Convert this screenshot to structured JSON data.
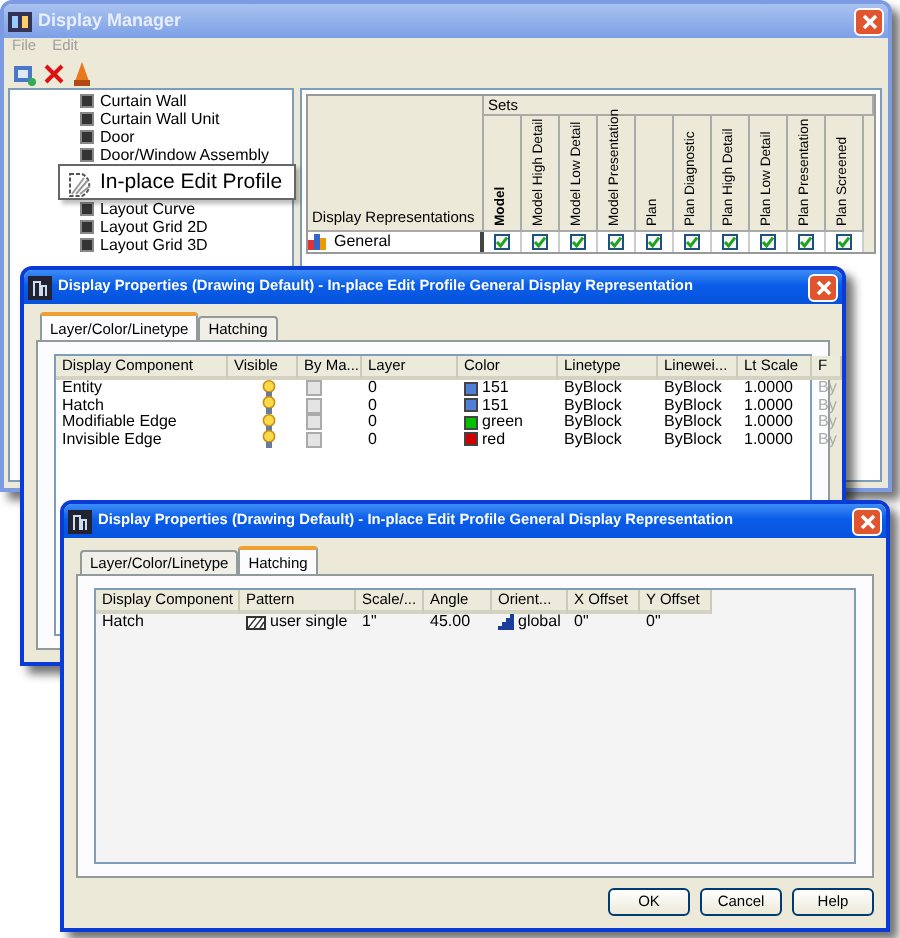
{
  "display_manager": {
    "title": "Display Manager",
    "menu": [
      "File",
      "Edit"
    ],
    "tree": [
      {
        "label": "Curtain Wall",
        "kind": "item"
      },
      {
        "label": "Curtain Wall Unit",
        "kind": "item"
      },
      {
        "label": "Door",
        "kind": "item"
      },
      {
        "label": "Door/Window Assembly",
        "kind": "item"
      },
      {
        "label": "In-place Edit Profile",
        "kind": "tooltip"
      },
      {
        "label": "Layout Curve",
        "kind": "item"
      },
      {
        "label": "Layout Grid 2D",
        "kind": "item"
      },
      {
        "label": "Layout Grid 3D",
        "kind": "item"
      }
    ],
    "representations_header": "Display Representations",
    "sets_header": "Sets",
    "sets": [
      {
        "label": "Model",
        "current": true
      },
      {
        "label": "Model High Detail",
        "current": false
      },
      {
        "label": "Model Low Detail",
        "current": false
      },
      {
        "label": "Model Presentation",
        "current": false
      },
      {
        "label": "Plan",
        "current": false
      },
      {
        "label": "Plan Diagnostic",
        "current": false
      },
      {
        "label": "Plan High Detail",
        "current": false
      },
      {
        "label": "Plan Low Detail",
        "current": false
      },
      {
        "label": "Plan Presentation",
        "current": false
      },
      {
        "label": "Plan Screened",
        "current": false
      }
    ],
    "rows": [
      {
        "label": "General",
        "checks": [
          true,
          true,
          true,
          true,
          true,
          true,
          true,
          true,
          true,
          true
        ]
      }
    ]
  },
  "properties_dialog": {
    "title": "Display Properties (Drawing Default) - In-place Edit Profile General Display Representation",
    "tabs": [
      {
        "label": "Layer/Color/Linetype",
        "selected": true
      },
      {
        "label": "Hatching",
        "selected": false
      }
    ],
    "columns": [
      "Display Component",
      "Visible",
      "By Ma...",
      "Layer",
      "Color",
      "Linetype",
      "Linewei...",
      "Lt Scale",
      "F"
    ],
    "rows": [
      {
        "component": "Entity",
        "visible": true,
        "by_material": false,
        "layer": "0",
        "color": "#4f7fd6",
        "color_name": "151",
        "linetype": "ByBlock",
        "lineweight": "ByBlock",
        "lt_scale": "1.0000",
        "column_9": "By"
      },
      {
        "component": "Hatch",
        "visible": true,
        "by_material": false,
        "layer": "0",
        "color": "#4f7fd6",
        "color_name": "151",
        "linetype": "ByBlock",
        "lineweight": "ByBlock",
        "lt_scale": "1.0000",
        "column_9": "By"
      },
      {
        "component": "Modifiable Edge",
        "visible": true,
        "by_material": false,
        "layer": "0",
        "color": "#00c000",
        "color_name": "green",
        "linetype": "ByBlock",
        "lineweight": "ByBlock",
        "lt_scale": "1.0000",
        "column_9": "By"
      },
      {
        "component": "Invisible Edge",
        "visible": true,
        "by_material": false,
        "layer": "0",
        "color": "#d00000",
        "color_name": "red",
        "linetype": "ByBlock",
        "lineweight": "ByBlock",
        "lt_scale": "1.0000",
        "column_9": "By"
      }
    ]
  },
  "hatching_dialog": {
    "title": "Display Properties (Drawing Default) - In-place Edit Profile General Display Representation",
    "tabs": [
      {
        "label": "Layer/Color/Linetype",
        "selected": false
      },
      {
        "label": "Hatching",
        "selected": true
      }
    ],
    "columns": [
      "Display Component",
      "Pattern",
      "Scale/...",
      "Angle",
      "Orient...",
      "X Offset",
      "Y Offset"
    ],
    "rows": [
      {
        "component": "Hatch",
        "pattern": "user single",
        "scale": "1\"",
        "angle": "45.00",
        "orientation": "global",
        "x_offset": "0\"",
        "y_offset": "0\""
      }
    ],
    "buttons": [
      "OK",
      "Cancel",
      "Help"
    ]
  }
}
